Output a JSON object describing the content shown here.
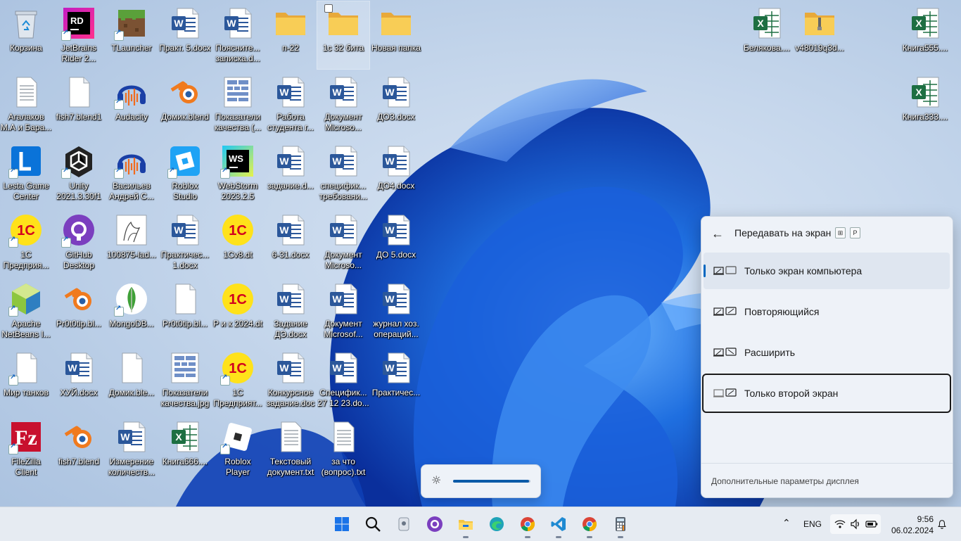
{
  "desktop": {
    "icons": [
      {
        "label": "Корзина",
        "icon": "recycle-bin-icon",
        "kind": "recycle",
        "col": 0,
        "row": 0,
        "shortcut": false
      },
      {
        "label": "JetBrains Rider 2...",
        "icon": "rider-icon",
        "kind": "rider",
        "col": 1,
        "row": 0,
        "shortcut": true
      },
      {
        "label": "TLauncher",
        "icon": "minecraft-icon",
        "kind": "minecraft",
        "col": 2,
        "row": 0,
        "shortcut": true
      },
      {
        "label": "Практ. 5.docx",
        "icon": "word-doc-icon",
        "kind": "word",
        "col": 3,
        "row": 0,
        "shortcut": false
      },
      {
        "label": "Поясните... записка.d...",
        "icon": "word-doc-icon",
        "kind": "word",
        "col": 4,
        "row": 0,
        "shortcut": false
      },
      {
        "label": "п-22",
        "icon": "folder-icon",
        "kind": "folder",
        "col": 5,
        "row": 0,
        "shortcut": false
      },
      {
        "label": "1с 32 бита",
        "icon": "folder-icon",
        "kind": "folder",
        "col": 6,
        "row": 0,
        "shortcut": false,
        "selected": true
      },
      {
        "label": "Новая папка",
        "icon": "folder-icon",
        "kind": "folder",
        "col": 7,
        "row": 0,
        "shortcut": false
      },
      {
        "label": "Агалаков М.А и Бара...",
        "icon": "text-file-icon",
        "kind": "txt",
        "col": 0,
        "row": 1,
        "shortcut": false
      },
      {
        "label": "fish7.blend1",
        "icon": "blank-file-icon",
        "kind": "blank",
        "col": 1,
        "row": 1,
        "shortcut": false
      },
      {
        "label": "Audacity",
        "icon": "audacity-icon",
        "kind": "audacity",
        "col": 2,
        "row": 1,
        "shortcut": true
      },
      {
        "label": "Домик.blend",
        "icon": "blender-icon",
        "kind": "blender",
        "col": 3,
        "row": 1,
        "shortcut": false
      },
      {
        "label": "Показатели качества (...",
        "icon": "image-file-icon",
        "kind": "image",
        "col": 4,
        "row": 1,
        "shortcut": false
      },
      {
        "label": "Работа студента г...",
        "icon": "word-doc-icon",
        "kind": "word",
        "col": 5,
        "row": 1,
        "shortcut": false
      },
      {
        "label": "Документ Microso...",
        "icon": "word-doc-icon",
        "kind": "word",
        "col": 6,
        "row": 1,
        "shortcut": false
      },
      {
        "label": "ДОЗ.docx",
        "icon": "word-doc-icon",
        "kind": "word",
        "col": 7,
        "row": 1,
        "shortcut": false
      },
      {
        "label": "Lesta Game Center",
        "icon": "lesta-icon",
        "kind": "lesta",
        "col": 0,
        "row": 2,
        "shortcut": true
      },
      {
        "label": "Unity 2021.3.30f1",
        "icon": "unity-icon",
        "kind": "unity",
        "col": 1,
        "row": 2,
        "shortcut": true
      },
      {
        "label": "Васильев Андрей С...",
        "icon": "audacity-icon",
        "kind": "audacity",
        "col": 2,
        "row": 2,
        "shortcut": true
      },
      {
        "label": "Roblox Studio",
        "icon": "roblox-studio-icon",
        "kind": "robloxstudio",
        "col": 3,
        "row": 2,
        "shortcut": true
      },
      {
        "label": "WebStorm 2023.2.5",
        "icon": "webstorm-icon",
        "kind": "webstorm",
        "col": 4,
        "row": 2,
        "shortcut": true
      },
      {
        "label": "задание.d...",
        "icon": "word-doc-icon",
        "kind": "word",
        "col": 5,
        "row": 2,
        "shortcut": false
      },
      {
        "label": "специфик... требовани...",
        "icon": "word-doc-icon",
        "kind": "word",
        "col": 6,
        "row": 2,
        "shortcut": false
      },
      {
        "label": "ДО4.docx",
        "icon": "word-doc-icon",
        "kind": "word",
        "col": 7,
        "row": 2,
        "shortcut": false
      },
      {
        "label": "1С Предприя...",
        "icon": "1c-icon",
        "kind": "onec",
        "col": 0,
        "row": 3,
        "shortcut": true
      },
      {
        "label": "GitHub Desktop",
        "icon": "github-desktop-icon",
        "kind": "github",
        "col": 1,
        "row": 3,
        "shortcut": true
      },
      {
        "label": "100875-lad...",
        "icon": "image-file-icon",
        "kind": "photo",
        "col": 2,
        "row": 3,
        "shortcut": false
      },
      {
        "label": "Практичес... 1.docx",
        "icon": "word-doc-icon",
        "kind": "word",
        "col": 3,
        "row": 3,
        "shortcut": false
      },
      {
        "label": "1Cv8.dt",
        "icon": "1c-icon",
        "kind": "onec",
        "col": 4,
        "row": 3,
        "shortcut": false
      },
      {
        "label": "6-31.docx",
        "icon": "word-doc-icon",
        "kind": "word",
        "col": 5,
        "row": 3,
        "shortcut": false
      },
      {
        "label": "Документ Microso...",
        "icon": "word-doc-icon",
        "kind": "word",
        "col": 6,
        "row": 3,
        "shortcut": false
      },
      {
        "label": "ДО 5.docx",
        "icon": "word-doc-icon",
        "kind": "word",
        "col": 7,
        "row": 3,
        "shortcut": false
      },
      {
        "label": "Apache NetBeans I...",
        "icon": "netbeans-icon",
        "kind": "netbeans",
        "col": 0,
        "row": 4,
        "shortcut": true
      },
      {
        "label": "Pr0t0tip.bl...",
        "icon": "blender-icon",
        "kind": "blender",
        "col": 1,
        "row": 4,
        "shortcut": false
      },
      {
        "label": "MongoDB...",
        "icon": "mongodb-icon",
        "kind": "mongo",
        "col": 2,
        "row": 4,
        "shortcut": true
      },
      {
        "label": "Pr0t0tip.bl...",
        "icon": "blank-file-icon",
        "kind": "blank",
        "col": 3,
        "row": 4,
        "shortcut": false
      },
      {
        "label": "Р и к 2024.dt",
        "icon": "1c-icon",
        "kind": "onec",
        "col": 4,
        "row": 4,
        "shortcut": false
      },
      {
        "label": "Задание ДЭ.docx",
        "icon": "word-doc-icon",
        "kind": "word",
        "col": 5,
        "row": 4,
        "shortcut": false
      },
      {
        "label": "Документ Microsof...",
        "icon": "word-doc-icon",
        "kind": "word",
        "col": 6,
        "row": 4,
        "shortcut": false
      },
      {
        "label": "журнал хоз. операций...",
        "icon": "word-doc-icon",
        "kind": "word",
        "col": 7,
        "row": 4,
        "shortcut": false
      },
      {
        "label": "Мир танков",
        "icon": "blank-file-icon",
        "kind": "blank",
        "col": 0,
        "row": 5,
        "shortcut": true
      },
      {
        "label": "ХУЙ.docx",
        "icon": "word-doc-icon",
        "kind": "word",
        "col": 1,
        "row": 5,
        "shortcut": false
      },
      {
        "label": "Домик.ble...",
        "icon": "blank-file-icon",
        "kind": "blank",
        "col": 2,
        "row": 5,
        "shortcut": false
      },
      {
        "label": "Показатели качества.jpg",
        "icon": "image-file-icon",
        "kind": "image",
        "col": 3,
        "row": 5,
        "shortcut": false
      },
      {
        "label": "1С Предприят...",
        "icon": "1c-icon",
        "kind": "onec",
        "col": 4,
        "row": 5,
        "shortcut": true
      },
      {
        "label": "Конкурсное задание.doc",
        "icon": "word-doc-icon",
        "kind": "word",
        "col": 5,
        "row": 5,
        "shortcut": false
      },
      {
        "label": "Специфик... 27 12 23.do...",
        "icon": "word-doc-icon",
        "kind": "word",
        "col": 6,
        "row": 5,
        "shortcut": false
      },
      {
        "label": "Практичес...",
        "icon": "word-doc-icon",
        "kind": "word",
        "col": 7,
        "row": 5,
        "shortcut": false
      },
      {
        "label": "FileZilla Client",
        "icon": "filezilla-icon",
        "kind": "filezilla",
        "col": 0,
        "row": 6,
        "shortcut": true
      },
      {
        "label": "fish7.blend",
        "icon": "blender-icon",
        "kind": "blender",
        "col": 1,
        "row": 6,
        "shortcut": false
      },
      {
        "label": "Измерение количеств...",
        "icon": "word-doc-icon",
        "kind": "word",
        "col": 2,
        "row": 6,
        "shortcut": false
      },
      {
        "label": "Книга666....",
        "icon": "excel-icon",
        "kind": "excel",
        "col": 3,
        "row": 6,
        "shortcut": false
      },
      {
        "label": "Roblox Player",
        "icon": "roblox-icon",
        "kind": "roblox",
        "col": 4,
        "row": 6,
        "shortcut": true
      },
      {
        "label": "Текстовый документ.txt",
        "icon": "text-file-icon",
        "kind": "txt",
        "col": 5,
        "row": 6,
        "shortcut": false
      },
      {
        "label": "за что (вопрос).txt",
        "icon": "text-file-icon",
        "kind": "txt",
        "col": 6,
        "row": 6,
        "shortcut": false
      },
      {
        "label": "Белякова....",
        "icon": "excel-icon",
        "kind": "excel",
        "col": 14,
        "row": 0,
        "shortcut": false
      },
      {
        "label": "v48019q3d...",
        "icon": "zip-folder-icon",
        "kind": "zipfolder",
        "col": 15,
        "row": 0,
        "shortcut": false
      },
      {
        "label": "Книга555....",
        "icon": "excel-icon",
        "kind": "excel",
        "col": 17,
        "row": 0,
        "shortcut": false
      },
      {
        "label": "Книга333....",
        "icon": "excel-icon",
        "kind": "excel",
        "col": 17,
        "row": 1,
        "shortcut": false
      }
    ]
  },
  "project_panel": {
    "title": "Передавать на экран",
    "key_hint": "P",
    "options": [
      {
        "label": "Только экран компьютера",
        "icon": "pc-screen-only-icon",
        "active": true,
        "focused": false
      },
      {
        "label": "Повторяющийся",
        "icon": "duplicate-icon",
        "active": false,
        "focused": false
      },
      {
        "label": "Расширить",
        "icon": "extend-icon",
        "active": false,
        "focused": false
      },
      {
        "label": "Только второй экран",
        "icon": "second-screen-only-icon",
        "active": false,
        "focused": true
      }
    ],
    "footer_link": "Дополнительные параметры дисплея"
  },
  "brightness": {
    "level": 0.98
  },
  "taskbar": {
    "apps": [
      {
        "name": "start-button",
        "icon": "windows-icon"
      },
      {
        "name": "search-button",
        "icon": "search-icon"
      },
      {
        "name": "taskbar-app-unknown",
        "icon": "app-icon"
      },
      {
        "name": "taskbar-github-desktop",
        "icon": "github-desktop-icon"
      },
      {
        "name": "taskbar-file-explorer",
        "icon": "folder-icon"
      },
      {
        "name": "taskbar-edge",
        "icon": "edge-icon"
      },
      {
        "name": "taskbar-chrome",
        "icon": "chrome-icon"
      },
      {
        "name": "taskbar-vscode",
        "icon": "vscode-icon"
      },
      {
        "name": "taskbar-chrome-2",
        "icon": "chrome-icon"
      },
      {
        "name": "taskbar-calculator",
        "icon": "calculator-icon"
      }
    ],
    "language": "ENG",
    "time": "9:56",
    "date": "06.02.2024"
  },
  "colors": {
    "accent": "#0067c0",
    "word": "#2b579a",
    "excel": "#1d6f42",
    "folder": "#f4c542"
  }
}
